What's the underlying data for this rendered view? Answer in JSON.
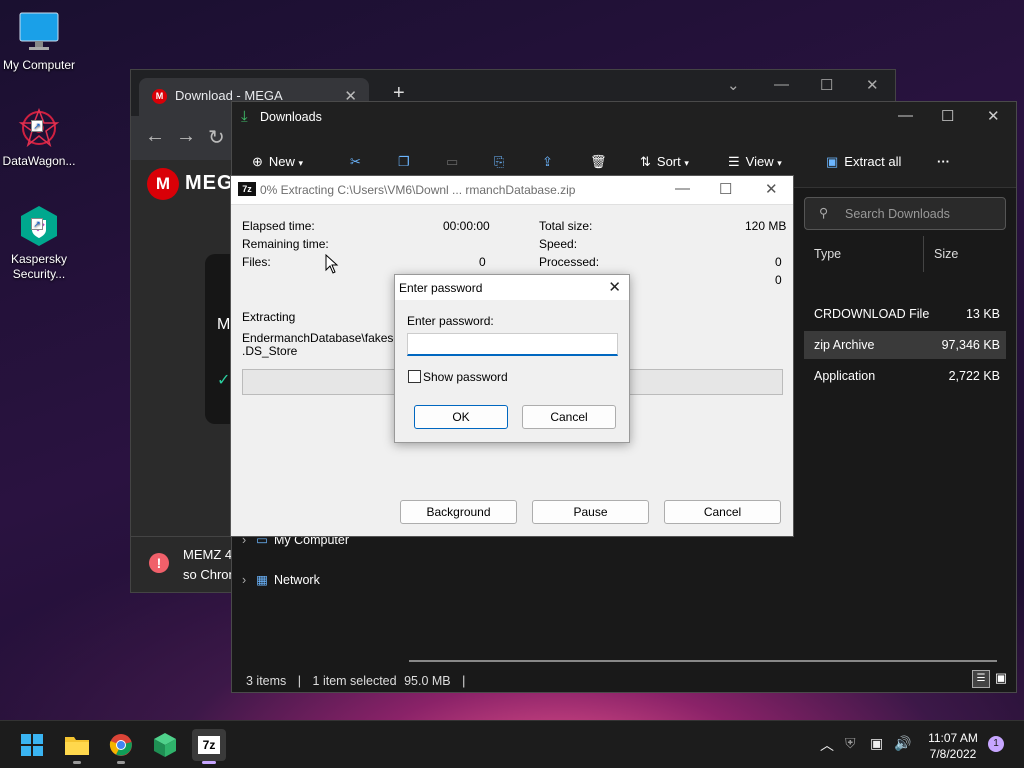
{
  "desktop": {
    "icons": [
      {
        "label": "My Computer"
      },
      {
        "label": "DataWagon..."
      },
      {
        "label_line1": "Kaspersky",
        "label_line2": "Security..."
      }
    ]
  },
  "chrome": {
    "tab_title": "Download - MEGA",
    "tab_close": "✕",
    "new_tab": "+",
    "favicon": "M",
    "logo_text": "MEG",
    "mega_letter": "M",
    "notification": {
      "line1": "MEMZ 4",
      "line2": "so Chron"
    }
  },
  "explorer": {
    "title": "Downloads",
    "toolbar": {
      "new": "New",
      "sort": "Sort",
      "view": "View",
      "extract_all": "Extract all",
      "more": "···"
    },
    "search_placeholder": "Search Downloads",
    "columns": {
      "type": "Type",
      "size": "Size"
    },
    "rows": [
      {
        "type": "CRDOWNLOAD File",
        "size": "13 KB"
      },
      {
        "type": "zip Archive",
        "size": "97,346 KB"
      },
      {
        "type": "Application",
        "size": "2,722 KB"
      }
    ],
    "nav": {
      "my_computer": "My Computer",
      "network": "Network"
    },
    "status": {
      "items": "3 items",
      "sep": "|",
      "selected": "1 item selected",
      "size": "95.0 MB"
    }
  },
  "sevenzip": {
    "title": "0% Extracting C:\\Users\\VM6\\Downl ... rmanchDatabase.zip",
    "elapsed_label": "Elapsed time:",
    "elapsed_value": "00:00:00",
    "remaining_label": "Remaining time:",
    "files_label": "Files:",
    "files_value": "0",
    "total_size_label": "Total size:",
    "total_size_value": "120 MB",
    "speed_label": "Speed:",
    "processed_label": "Processed:",
    "processed_value": "0",
    "extra_value": "0",
    "extracting_label": "Extracting",
    "current_path": "EndermanchDatabase\\fakescar",
    "current_file": ".DS_Store",
    "buttons": {
      "background": "Background",
      "pause": "Pause",
      "cancel": "Cancel"
    }
  },
  "password_dialog": {
    "title": "Enter password",
    "prompt": "Enter password:",
    "value": "",
    "show_password": "Show password",
    "ok": "OK",
    "cancel": "Cancel"
  },
  "taskbar": {
    "seven_zip_label": "7z",
    "time": "11:07 AM",
    "date": "7/8/2022",
    "notification_count": "1"
  }
}
